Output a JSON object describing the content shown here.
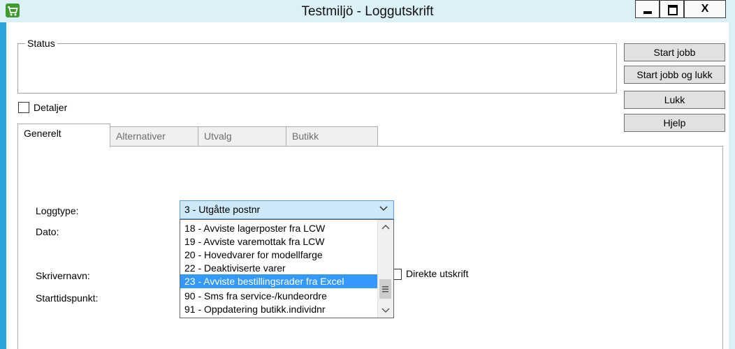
{
  "window": {
    "title": "Testmiljö  -  Loggutskrift",
    "close_glyph": "X"
  },
  "status": {
    "label": "Status",
    "details_label": "Detaljer"
  },
  "buttons": {
    "start": "Start jobb",
    "start_close": "Start jobb og lukk",
    "close": "Lukk",
    "help": "Hjelp"
  },
  "tabs": [
    {
      "label": "Generelt",
      "active": true
    },
    {
      "label": "Alternativer",
      "active": false
    },
    {
      "label": "Utvalg",
      "active": false
    },
    {
      "label": "Butikk",
      "active": false
    }
  ],
  "form": {
    "logtype_label": "Loggtype:",
    "date_label": "Dato:",
    "printer_label": "Skrivernavn:",
    "start_time_label": "Starttidspunkt:",
    "direct_print_label": "Direkte utskrift",
    "logtype_value": "3 - Utgåtte postnr",
    "dropdown_items": [
      {
        "label": "18 - Avviste lagerposter fra LCW",
        "selected": false
      },
      {
        "label": "19 - Avviste varemottak fra LCW",
        "selected": false
      },
      {
        "label": "20 - Hovedvarer for modellfarge",
        "selected": false
      },
      {
        "label": "22 - Deaktiviserte varer",
        "selected": false
      },
      {
        "label": "23 - Avviste bestillingsrader fra Excel",
        "selected": true
      },
      {
        "label": "90 - Sms fra service-/kundeordre",
        "selected": false
      },
      {
        "label": "91 - Oppdatering butikk.individnr",
        "selected": false
      }
    ]
  },
  "icons": {
    "app": "cart-icon",
    "minimize": "minimize-icon",
    "maximize": "maximize-icon",
    "close": "close-icon",
    "combo_arrow": "chevron-down-icon",
    "scroll_up": "chevron-up-icon",
    "scroll_down": "chevron-down-icon"
  },
  "colors": {
    "title_bg": "#dcf0f8",
    "left_border": "#2aa4dc",
    "selection": "#3399ff",
    "combo_bg": "#cde8f6",
    "combo_border": "#569de5"
  }
}
